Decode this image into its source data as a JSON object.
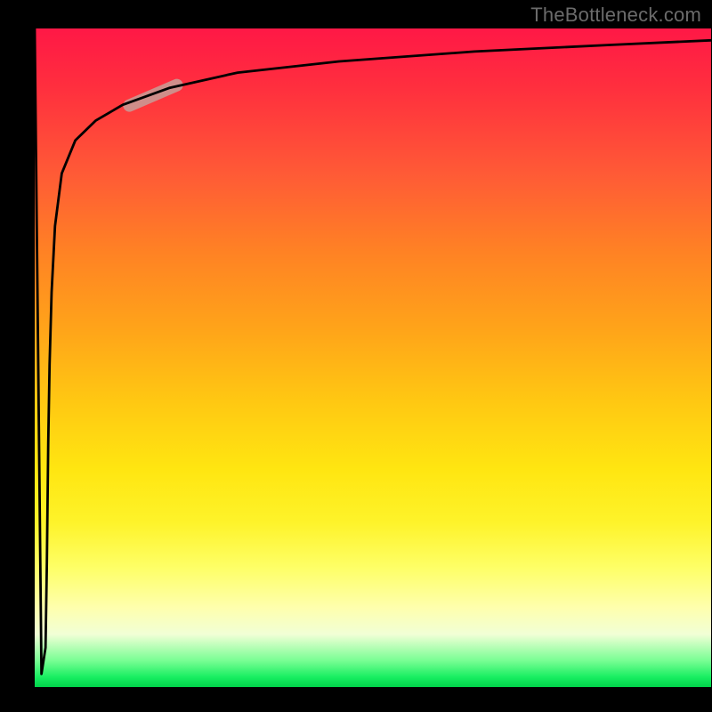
{
  "watermark": "TheBottleneck.com",
  "chart_data": {
    "type": "line",
    "title": "",
    "xlabel": "",
    "ylabel": "",
    "xlim": [
      0,
      1
    ],
    "ylim": [
      0,
      1
    ],
    "x": [
      0.0,
      0.01,
      0.016,
      0.018,
      0.02,
      0.022,
      0.025,
      0.03,
      0.04,
      0.06,
      0.09,
      0.13,
      0.2,
      0.3,
      0.45,
      0.65,
      0.85,
      1.0
    ],
    "values": [
      1.0,
      0.02,
      0.06,
      0.19,
      0.37,
      0.49,
      0.6,
      0.7,
      0.78,
      0.83,
      0.86,
      0.884,
      0.91,
      0.933,
      0.95,
      0.965,
      0.975,
      0.982
    ],
    "highlight_segment": {
      "x_start": 0.14,
      "x_end": 0.21,
      "y_start": 0.883,
      "y_end": 0.914
    },
    "gradient_stops": [
      {
        "pos": 0.0,
        "color": "#ff1846"
      },
      {
        "pos": 0.22,
        "color": "#ff5a36"
      },
      {
        "pos": 0.46,
        "color": "#ffa519"
      },
      {
        "pos": 0.67,
        "color": "#ffe611"
      },
      {
        "pos": 0.88,
        "color": "#feffae"
      },
      {
        "pos": 1.0,
        "color": "#00d24a"
      }
    ]
  }
}
